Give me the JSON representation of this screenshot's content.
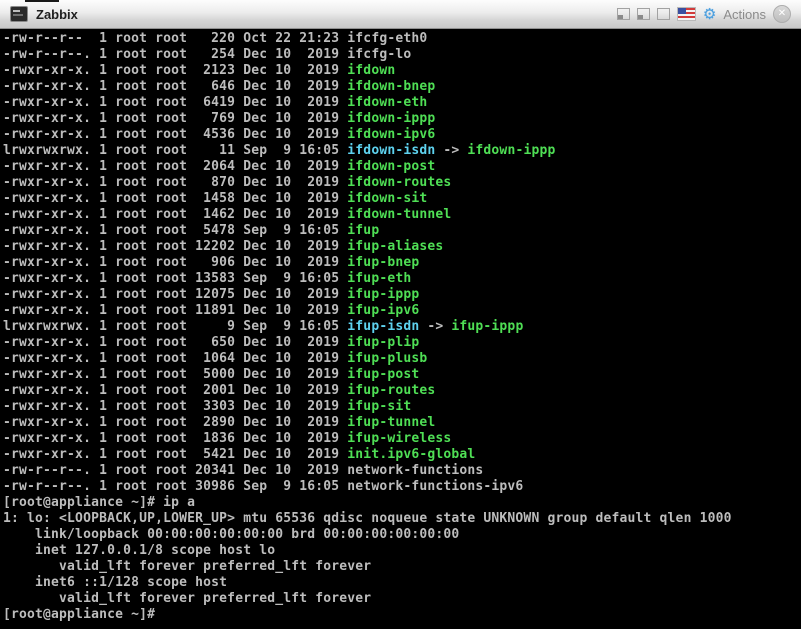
{
  "titlebar": {
    "title": "Zabbix",
    "actions_label": "Actions",
    "close_glyph": "✕",
    "gear_glyph": "⚙"
  },
  "colors": {
    "terminal_background": "#000000",
    "terminal_foreground": "#bdbdbd",
    "executable_green": "#4fdf55",
    "symlink_cyan": "#5ed2ef",
    "gear_blue": "#4a9ede"
  },
  "terminal": {
    "lines": [
      [
        [
          "-rw-r--r--  1 root root   220 Oct 22 21:23 ",
          "fg"
        ],
        [
          "ifcfg-eth0",
          "fg"
        ]
      ],
      [
        [
          "-rw-r--r--. 1 root root   254 Dec 10  2019 ",
          "fg"
        ],
        [
          "ifcfg-lo",
          "fg"
        ]
      ],
      [
        [
          "-rwxr-xr-x. 1 root root  2123 Dec 10  2019 ",
          "fg"
        ],
        [
          "ifdown",
          "green"
        ]
      ],
      [
        [
          "-rwxr-xr-x. 1 root root   646 Dec 10  2019 ",
          "fg"
        ],
        [
          "ifdown-bnep",
          "green"
        ]
      ],
      [
        [
          "-rwxr-xr-x. 1 root root  6419 Dec 10  2019 ",
          "fg"
        ],
        [
          "ifdown-eth",
          "green"
        ]
      ],
      [
        [
          "-rwxr-xr-x. 1 root root   769 Dec 10  2019 ",
          "fg"
        ],
        [
          "ifdown-ippp",
          "green"
        ]
      ],
      [
        [
          "-rwxr-xr-x. 1 root root  4536 Dec 10  2019 ",
          "fg"
        ],
        [
          "ifdown-ipv6",
          "green"
        ]
      ],
      [
        [
          "lrwxrwxrwx. 1 root root    11 Sep  9 16:05 ",
          "fg"
        ],
        [
          "ifdown-isdn",
          "cyan"
        ],
        [
          " -> ",
          "fg"
        ],
        [
          "ifdown-ippp",
          "green"
        ]
      ],
      [
        [
          "-rwxr-xr-x. 1 root root  2064 Dec 10  2019 ",
          "fg"
        ],
        [
          "ifdown-post",
          "green"
        ]
      ],
      [
        [
          "-rwxr-xr-x. 1 root root   870 Dec 10  2019 ",
          "fg"
        ],
        [
          "ifdown-routes",
          "green"
        ]
      ],
      [
        [
          "-rwxr-xr-x. 1 root root  1458 Dec 10  2019 ",
          "fg"
        ],
        [
          "ifdown-sit",
          "green"
        ]
      ],
      [
        [
          "-rwxr-xr-x. 1 root root  1462 Dec 10  2019 ",
          "fg"
        ],
        [
          "ifdown-tunnel",
          "green"
        ]
      ],
      [
        [
          "-rwxr-xr-x. 1 root root  5478 Sep  9 16:05 ",
          "fg"
        ],
        [
          "ifup",
          "green"
        ]
      ],
      [
        [
          "-rwxr-xr-x. 1 root root 12202 Dec 10  2019 ",
          "fg"
        ],
        [
          "ifup-aliases",
          "green"
        ]
      ],
      [
        [
          "-rwxr-xr-x. 1 root root   906 Dec 10  2019 ",
          "fg"
        ],
        [
          "ifup-bnep",
          "green"
        ]
      ],
      [
        [
          "-rwxr-xr-x. 1 root root 13583 Sep  9 16:05 ",
          "fg"
        ],
        [
          "ifup-eth",
          "green"
        ]
      ],
      [
        [
          "-rwxr-xr-x. 1 root root 12075 Dec 10  2019 ",
          "fg"
        ],
        [
          "ifup-ippp",
          "green"
        ]
      ],
      [
        [
          "-rwxr-xr-x. 1 root root 11891 Dec 10  2019 ",
          "fg"
        ],
        [
          "ifup-ipv6",
          "green"
        ]
      ],
      [
        [
          "lrwxrwxrwx. 1 root root     9 Sep  9 16:05 ",
          "fg"
        ],
        [
          "ifup-isdn",
          "cyan"
        ],
        [
          " -> ",
          "fg"
        ],
        [
          "ifup-ippp",
          "green"
        ]
      ],
      [
        [
          "-rwxr-xr-x. 1 root root   650 Dec 10  2019 ",
          "fg"
        ],
        [
          "ifup-plip",
          "green"
        ]
      ],
      [
        [
          "-rwxr-xr-x. 1 root root  1064 Dec 10  2019 ",
          "fg"
        ],
        [
          "ifup-plusb",
          "green"
        ]
      ],
      [
        [
          "-rwxr-xr-x. 1 root root  5000 Dec 10  2019 ",
          "fg"
        ],
        [
          "ifup-post",
          "green"
        ]
      ],
      [
        [
          "-rwxr-xr-x. 1 root root  2001 Dec 10  2019 ",
          "fg"
        ],
        [
          "ifup-routes",
          "green"
        ]
      ],
      [
        [
          "-rwxr-xr-x. 1 root root  3303 Dec 10  2019 ",
          "fg"
        ],
        [
          "ifup-sit",
          "green"
        ]
      ],
      [
        [
          "-rwxr-xr-x. 1 root root  2890 Dec 10  2019 ",
          "fg"
        ],
        [
          "ifup-tunnel",
          "green"
        ]
      ],
      [
        [
          "-rwxr-xr-x. 1 root root  1836 Dec 10  2019 ",
          "fg"
        ],
        [
          "ifup-wireless",
          "green"
        ]
      ],
      [
        [
          "-rwxr-xr-x. 1 root root  5421 Dec 10  2019 ",
          "fg"
        ],
        [
          "init.ipv6-global",
          "green"
        ]
      ],
      [
        [
          "-rw-r--r--. 1 root root 20341 Dec 10  2019 ",
          "fg"
        ],
        [
          "network-functions",
          "fg"
        ]
      ],
      [
        [
          "-rw-r--r--. 1 root root 30986 Sep  9 16:05 ",
          "fg"
        ],
        [
          "network-functions-ipv6",
          "fg"
        ]
      ],
      [
        [
          "[root@appliance ~]# ip a",
          "fg"
        ]
      ],
      [
        [
          "1: lo: <LOOPBACK,UP,LOWER_UP> mtu 65536 qdisc noqueue state UNKNOWN group default qlen 1000",
          "fg"
        ]
      ],
      [
        [
          "    link/loopback 00:00:00:00:00:00 brd 00:00:00:00:00:00",
          "fg"
        ]
      ],
      [
        [
          "    inet 127.0.0.1/8 scope host lo",
          "fg"
        ]
      ],
      [
        [
          "       valid_lft forever preferred_lft forever",
          "fg"
        ]
      ],
      [
        [
          "    inet6 ::1/128 scope host",
          "fg"
        ]
      ],
      [
        [
          "       valid_lft forever preferred_lft forever",
          "fg"
        ]
      ],
      [
        [
          "[root@appliance ~]#",
          "fg"
        ]
      ]
    ]
  }
}
